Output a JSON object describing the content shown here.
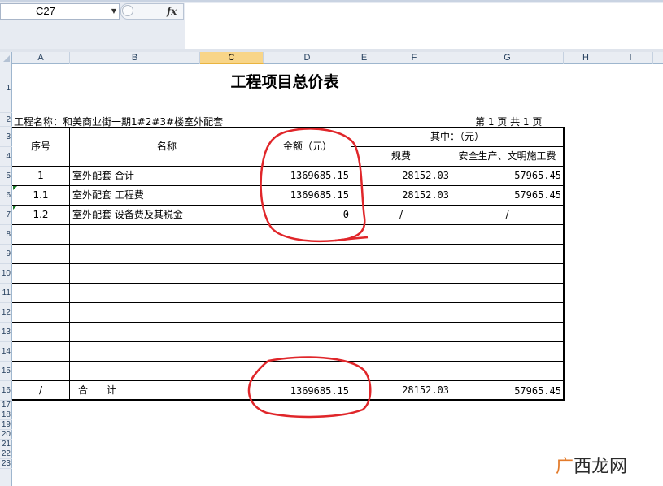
{
  "formula_bar": {
    "name_box": "C27",
    "fx_label": "fx",
    "formula_value": ""
  },
  "columns": [
    "A",
    "B",
    "C",
    "D",
    "E",
    "F",
    "G",
    "H",
    "I"
  ],
  "selected_column": "C",
  "rows": [
    "1",
    "2",
    "3",
    "4",
    "5",
    "6",
    "7",
    "8",
    "9",
    "10",
    "11",
    "12",
    "13",
    "14",
    "15",
    "16",
    "17",
    "18",
    "19",
    "20",
    "21",
    "22",
    "23"
  ],
  "sheet": {
    "title": "工程项目总价表",
    "project_label": "工程名称：和美商业街一期1#2#3#楼室外配套",
    "page_info": "第 1 页   共 1 页",
    "headers": {
      "seq": "序号",
      "name": "名称",
      "amount": "金额（元）",
      "of_which": "其中：（元）",
      "fees": "规费",
      "safety": "安全生产、文明施工费"
    },
    "items": [
      {
        "seq": "1",
        "name": "室外配套 合计",
        "amount": "1369685.15",
        "fees": "28152.03",
        "safety": "57965.45"
      },
      {
        "seq": "1.1",
        "name": "室外配套 工程费",
        "amount": "1369685.15",
        "fees": "28152.03",
        "safety": "57965.45"
      },
      {
        "seq": "1.2",
        "name": "室外配套 设备费及其税金",
        "amount": "0",
        "fees": "/",
        "safety": "/"
      }
    ],
    "total": {
      "seq": "/",
      "name": "合      计",
      "amount": "1369685.15",
      "fees": "28152.03",
      "safety": "57965.45"
    }
  },
  "watermark": {
    "mark": "广",
    "text": "西龙网"
  },
  "colors": {
    "annotation_red": "#e0262a",
    "selected_header": "#f8d588",
    "header_bg": "#e9edf3"
  }
}
